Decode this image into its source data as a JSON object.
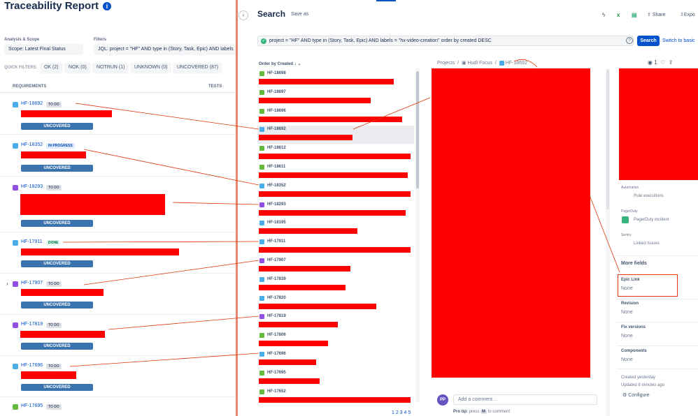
{
  "left": {
    "title": "Traceability Report",
    "info_icon": "info-icon",
    "scope_label": "Analysis & Scope",
    "scope_value": "Scope: Latest Final Status",
    "filters_label": "Filters",
    "filters_value": "JQL: project = \"HF\" AND type in (Story, Task, Epic) AND labels",
    "quick_filters_label": "QUICK FILTERS:",
    "quick_filters": [
      "OK (2)",
      "NOK (0)",
      "NOTRUN (1)",
      "UNKNOWN (0)",
      "UNCOVERED (87)"
    ],
    "col_requirements": "REQUIREMENTS",
    "col_tests": "TESTS",
    "uncovered_label": "UNCOVERED",
    "rows": [
      {
        "key": "HF-18692",
        "status": "TO DO",
        "type": "task"
      },
      {
        "key": "HF-18352",
        "status": "IN PROGRESS",
        "type": "task"
      },
      {
        "key": "HF-18293",
        "status": "TO DO",
        "type": "epic"
      },
      {
        "key": "HF-17911",
        "status": "DONE",
        "type": "task"
      },
      {
        "key": "HF-17907",
        "status": "TO DO",
        "type": "epic"
      },
      {
        "key": "HF-17819",
        "status": "TO DO",
        "type": "epic"
      },
      {
        "key": "HF-17696",
        "status": "TO DO",
        "type": "task"
      },
      {
        "key": "HF-17695",
        "status": "TO DO",
        "type": "story"
      }
    ]
  },
  "search": {
    "title": "Search",
    "save_as": "Save as",
    "share": "Share",
    "export": "Expo",
    "jql": "project = \"HF\" AND type in (Story, Task, Epic) AND labels = \"hx-video-creation\" order by created DESC",
    "search_button": "Search",
    "switch_basic": "Switch to basic",
    "order_by": "Order by Created",
    "list": [
      {
        "key": "HF-18698",
        "type": "story"
      },
      {
        "key": "HF-18697",
        "type": "story"
      },
      {
        "key": "HF-18696",
        "type": "story"
      },
      {
        "key": "HF-18692",
        "type": "task"
      },
      {
        "key": "HF-18612",
        "type": "story"
      },
      {
        "key": "HF-18611",
        "type": "story"
      },
      {
        "key": "HF-18352",
        "type": "task"
      },
      {
        "key": "HF-18293",
        "type": "epic"
      },
      {
        "key": "HF-18195",
        "type": "task"
      },
      {
        "key": "HF-17911",
        "type": "task"
      },
      {
        "key": "HF-17907",
        "type": "epic"
      },
      {
        "key": "HF-17839",
        "type": "task"
      },
      {
        "key": "HF-17820",
        "type": "task"
      },
      {
        "key": "HF-17819",
        "type": "epic"
      },
      {
        "key": "HF-17806",
        "type": "story"
      },
      {
        "key": "HF-17696",
        "type": "task"
      },
      {
        "key": "HF-17695",
        "type": "story"
      },
      {
        "key": "HF-17652",
        "type": "story"
      }
    ],
    "pager": "1 2 3 4 5"
  },
  "detail": {
    "breadcrumb_projects": "Projects",
    "breadcrumb_project": "Hudl Focus",
    "breadcrumb_issue": "HF-18692",
    "watch_count": "1",
    "automation_label": "Automation",
    "automation_value": "Rule executions",
    "pagerduty_label": "PagerDuty",
    "pagerduty_value": "PagerDuty incident",
    "sentry_label": "Sentry",
    "sentry_value": "Linked Issues",
    "more_fields": "More fields",
    "fields": [
      {
        "label": "Epic Link",
        "value": "None"
      },
      {
        "label": "Revision",
        "value": "None"
      },
      {
        "label": "Fix versions",
        "value": "None"
      },
      {
        "label": "Components",
        "value": "None"
      }
    ],
    "created": "Created yesterday",
    "updated": "Updated 8 minutes ago",
    "configure": "Configure",
    "avatar": "PP",
    "comment_placeholder": "Add a comment…",
    "protip_prefix": "Pro tip:",
    "protip_press": "press",
    "protip_key": "M",
    "protip_suffix": "to comment"
  },
  "colors": {
    "accent": "#0052cc",
    "redaction": "#ff0000",
    "uncovered": "#3b73af",
    "connector": "#de350b"
  }
}
